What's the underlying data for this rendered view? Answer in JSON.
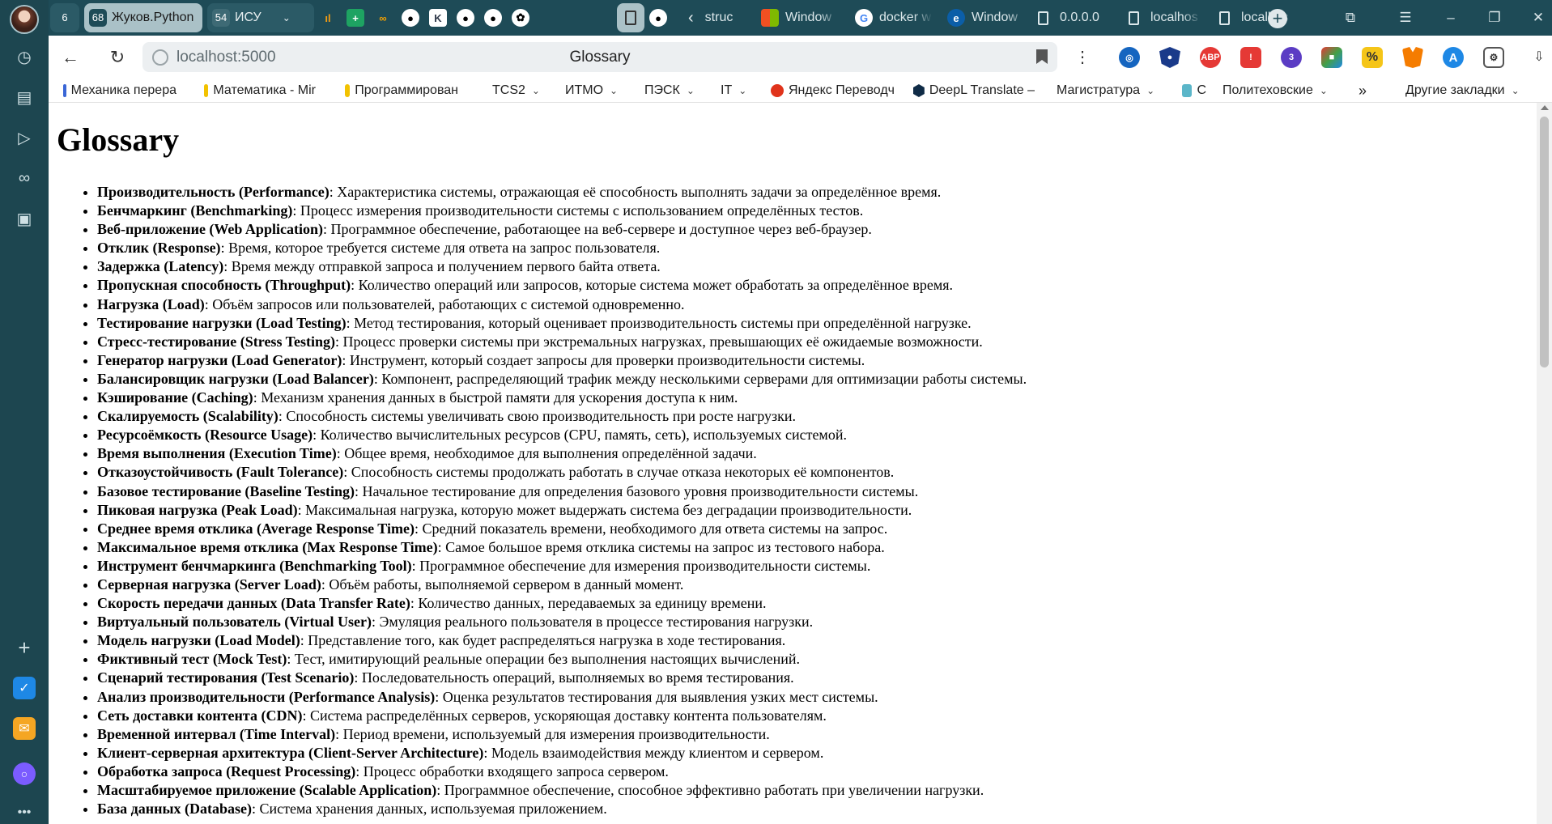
{
  "tabs": [
    {
      "count": "6",
      "label": ""
    },
    {
      "count": "68",
      "label": "Жуков.Python"
    },
    {
      "count": "54",
      "label": "ИСУ"
    },
    {
      "label": "struc"
    },
    {
      "label": "Window"
    },
    {
      "label": "docker w"
    },
    {
      "label": "Window"
    },
    {
      "label": "0.0.0.0"
    },
    {
      "label": "localhos"
    },
    {
      "label": "localhos"
    }
  ],
  "toolbar": {
    "url": "localhost:5000",
    "page_title": "Glossary"
  },
  "extensions": [
    "ABP",
    "3"
  ],
  "bookmarks": [
    {
      "label": "Механика перера",
      "color": "#3a66d6"
    },
    {
      "label": "Математика - Mir",
      "color": "#f2c200"
    },
    {
      "label": "Программирован",
      "color": "#f2c200"
    },
    {
      "label": "TCS2",
      "folder": true
    },
    {
      "label": "ИТМО",
      "folder": true
    },
    {
      "label": "ПЭСК",
      "folder": true
    },
    {
      "label": "IT",
      "folder": true
    },
    {
      "label": "Яндекс Переводч",
      "color": "#e0331b"
    },
    {
      "label": "DeepL Translate –",
      "color": "#0f2b46"
    },
    {
      "label": "Магистратура",
      "folder": true
    },
    {
      "label": "C",
      "color": "#5bb6c9"
    },
    {
      "label": "Политеховские",
      "folder": true
    }
  ],
  "other_bookmarks": "Другие закладки",
  "more_bookmarks": "»",
  "page": {
    "heading": "Glossary",
    "terms": [
      {
        "term": "Производительность (Performance)",
        "def": ": Характеристика системы, отражающая её способность выполнять задачи за определённое время."
      },
      {
        "term": "Бенчмаркинг (Benchmarking)",
        "def": ": Процесс измерения производительности системы с использованием определённых тестов."
      },
      {
        "term": "Веб-приложение (Web Application)",
        "def": ": Программное обеспечение, работающее на веб-сервере и доступное через веб-браузер."
      },
      {
        "term": "Отклик (Response)",
        "def": ": Время, которое требуется системе для ответа на запрос пользователя."
      },
      {
        "term": "Задержка (Latency)",
        "def": ": Время между отправкой запроса и получением первого байта ответа."
      },
      {
        "term": "Пропускная способность (Throughput)",
        "def": ": Количество операций или запросов, которые система может обработать за определённое время."
      },
      {
        "term": "Нагрузка (Load)",
        "def": ": Объём запросов или пользователей, работающих с системой одновременно."
      },
      {
        "term": "Тестирование нагрузки (Load Testing)",
        "def": ": Метод тестирования, который оценивает производительность системы при определённой нагрузке."
      },
      {
        "term": "Стресс-тестирование (Stress Testing)",
        "def": ": Процесс проверки системы при экстремальных нагрузках, превышающих её ожидаемые возможности."
      },
      {
        "term": "Генератор нагрузки (Load Generator)",
        "def": ": Инструмент, который создает запросы для проверки производительности системы."
      },
      {
        "term": "Балансировщик нагрузки (Load Balancer)",
        "def": ": Компонент, распределяющий трафик между несколькими серверами для оптимизации работы системы."
      },
      {
        "term": "Кэширование (Caching)",
        "def": ": Механизм хранения данных в быстрой памяти для ускорения доступа к ним."
      },
      {
        "term": "Скалируемость (Scalability)",
        "def": ": Способность системы увеличивать свою производительность при росте нагрузки."
      },
      {
        "term": "Ресурсоёмкость (Resource Usage)",
        "def": ": Количество вычислительных ресурсов (CPU, память, сеть), используемых системой."
      },
      {
        "term": "Время выполнения (Execution Time)",
        "def": ": Общее время, необходимое для выполнения определённой задачи."
      },
      {
        "term": "Отказоустойчивость (Fault Tolerance)",
        "def": ": Способность системы продолжать работать в случае отказа некоторых её компонентов."
      },
      {
        "term": "Базовое тестирование (Baseline Testing)",
        "def": ": Начальное тестирование для определения базового уровня производительности системы."
      },
      {
        "term": "Пиковая нагрузка (Peak Load)",
        "def": ": Максимальная нагрузка, которую может выдержать система без деградации производительности."
      },
      {
        "term": "Среднее время отклика (Average Response Time)",
        "def": ": Средний показатель времени, необходимого для ответа системы на запрос."
      },
      {
        "term": "Максимальное время отклика (Max Response Time)",
        "def": ": Самое большое время отклика системы на запрос из тестового набора."
      },
      {
        "term": "Инструмент бенчмаркинга (Benchmarking Tool)",
        "def": ": Программное обеспечение для измерения производительности системы."
      },
      {
        "term": "Серверная нагрузка (Server Load)",
        "def": ": Объём работы, выполняемой сервером в данный момент."
      },
      {
        "term": "Скорость передачи данных (Data Transfer Rate)",
        "def": ": Количество данных, передаваемых за единицу времени."
      },
      {
        "term": "Виртуальный пользователь (Virtual User)",
        "def": ": Эмуляция реального пользователя в процессе тестирования нагрузки."
      },
      {
        "term": "Модель нагрузки (Load Model)",
        "def": ": Представление того, как будет распределяться нагрузка в ходе тестирования."
      },
      {
        "term": "Фиктивный тест (Mock Test)",
        "def": ": Тест, имитирующий реальные операции без выполнения настоящих вычислений."
      },
      {
        "term": "Сценарий тестирования (Test Scenario)",
        "def": ": Последовательность операций, выполняемых во время тестирования."
      },
      {
        "term": "Анализ производительности (Performance Analysis)",
        "def": ": Оценка результатов тестирования для выявления узких мест системы."
      },
      {
        "term": "Сеть доставки контента (CDN)",
        "def": ": Система распределённых серверов, ускоряющая доставку контента пользователям."
      },
      {
        "term": "Временной интервал (Time Interval)",
        "def": ": Период времени, используемый для измерения производительности."
      },
      {
        "term": "Клиент-серверная архитектура (Client-Server Architecture)",
        "def": ": Модель взаимодействия между клиентом и сервером."
      },
      {
        "term": "Обработка запроса (Request Processing)",
        "def": ": Процесс обработки входящего запроса сервером."
      },
      {
        "term": "Масштабируемое приложение (Scalable Application)",
        "def": ": Программное обеспечение, способное эффективно работать при увеличении нагрузки."
      },
      {
        "term": "База данных (Database)",
        "def": ": Система хранения данных, используемая приложением."
      }
    ]
  }
}
